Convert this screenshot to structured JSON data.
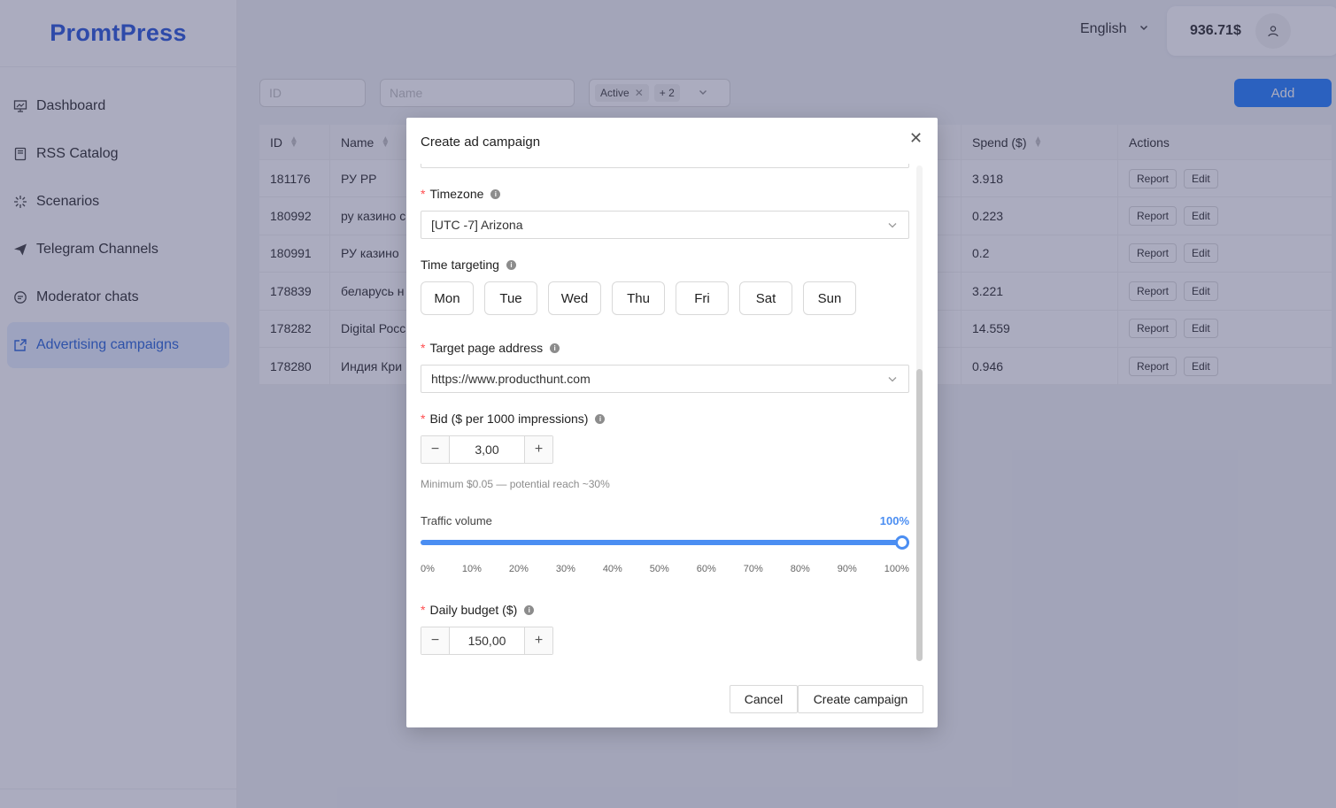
{
  "app": {
    "logo": "PromtPress"
  },
  "sidebar": {
    "items": [
      {
        "label": "Dashboard",
        "icon": "presentation-icon",
        "active": false
      },
      {
        "label": "RSS Catalog",
        "icon": "book-icon",
        "active": false
      },
      {
        "label": "Scenarios",
        "icon": "sparkle-icon",
        "active": false
      },
      {
        "label": "Telegram Channels",
        "icon": "send-icon",
        "active": false
      },
      {
        "label": "Moderator chats",
        "icon": "chat-icon",
        "active": false
      },
      {
        "label": "Advertising campaigns",
        "icon": "export-icon",
        "active": true
      }
    ]
  },
  "header": {
    "language": "English",
    "balance": "936.71$"
  },
  "filters": {
    "id_placeholder": "ID",
    "name_placeholder": "Name",
    "status_tag": "Active",
    "status_more": "+ 2",
    "add_label": "Add"
  },
  "table": {
    "headers": {
      "id": "ID",
      "name": "Name",
      "spend": "Spend ($)",
      "actions": "Actions"
    },
    "report_label": "Report",
    "edit_label": "Edit",
    "rows": [
      {
        "id": "181176",
        "name": "РУ РР",
        "spend": "3.918"
      },
      {
        "id": "180992",
        "name": "ру казино с",
        "spend": "0.223"
      },
      {
        "id": "180991",
        "name": "РУ казино",
        "spend": "0.2"
      },
      {
        "id": "178839",
        "name": "беларусь н",
        "spend": "3.221"
      },
      {
        "id": "178282",
        "name": "Digital Росс",
        "spend": "14.559"
      },
      {
        "id": "178280",
        "name": "Индия Кри",
        "spend": "0.946"
      }
    ]
  },
  "modal": {
    "title": "Create ad campaign",
    "timezone": {
      "label": "Timezone",
      "value": "[UTC -7] Arizona"
    },
    "time_targeting": {
      "label": "Time targeting",
      "days": [
        "Mon",
        "Tue",
        "Wed",
        "Thu",
        "Fri",
        "Sat",
        "Sun"
      ]
    },
    "target_page": {
      "label": "Target page address",
      "value": "https://www.producthunt.com"
    },
    "bid": {
      "label": "Bid ($ per 1000 impressions)",
      "value": "3,00",
      "hint": "Minimum $0.05 — potential reach ~30%"
    },
    "traffic": {
      "label": "Traffic volume",
      "value_label": "100%",
      "value_fraction": 1.0,
      "ticks": [
        "0%",
        "10%",
        "20%",
        "30%",
        "40%",
        "50%",
        "60%",
        "70%",
        "80%",
        "90%",
        "100%"
      ]
    },
    "daily_budget": {
      "label": "Daily budget ($)",
      "value": "150,00"
    },
    "cancel_label": "Cancel",
    "create_label": "Create campaign"
  }
}
